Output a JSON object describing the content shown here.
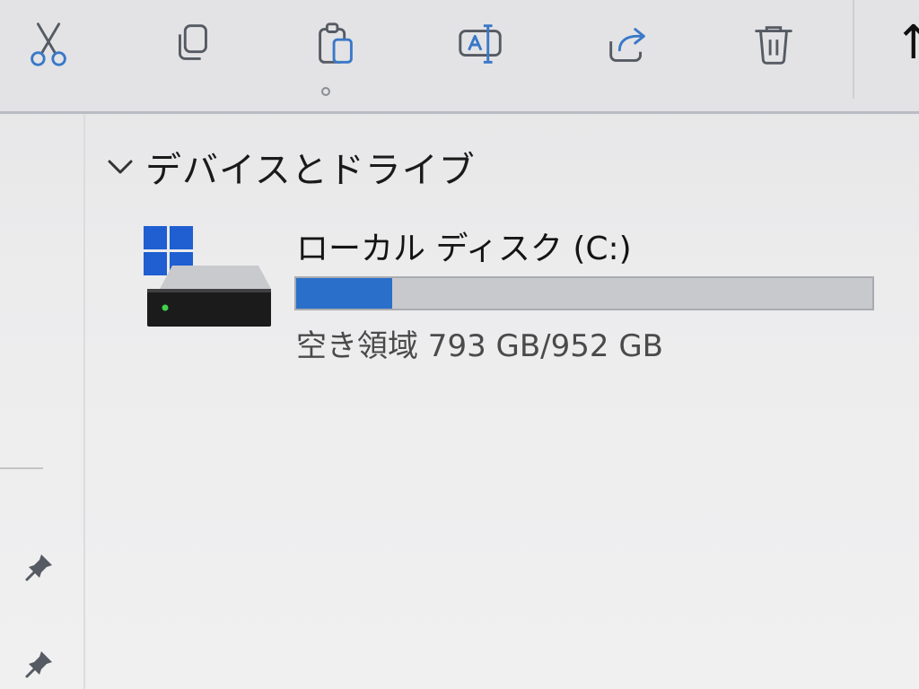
{
  "toolbar": {
    "buttons": [
      {
        "name": "cut",
        "icon": "scissors-icon"
      },
      {
        "name": "copy",
        "icon": "copy-icon"
      },
      {
        "name": "paste",
        "icon": "clipboard-icon"
      },
      {
        "name": "rename",
        "icon": "rename-icon"
      },
      {
        "name": "share",
        "icon": "share-icon"
      },
      {
        "name": "delete",
        "icon": "trash-icon"
      }
    ],
    "overflow_glyph": "↑"
  },
  "section": {
    "title": "デバイスとドライブ",
    "expanded": true
  },
  "drive": {
    "name": "ローカル ディスク (C:)",
    "free_text": "空き領域 793 GB/952 GB",
    "free_gb": 793,
    "total_gb": 952,
    "used_fraction": 0.167,
    "bar_color": "#2a6fc9",
    "icon": "hard-drive-windows-icon"
  },
  "colors": {
    "accent": "#2a6fc9",
    "windows_logo": "#1f5fd1",
    "led": "#3fd24a"
  }
}
